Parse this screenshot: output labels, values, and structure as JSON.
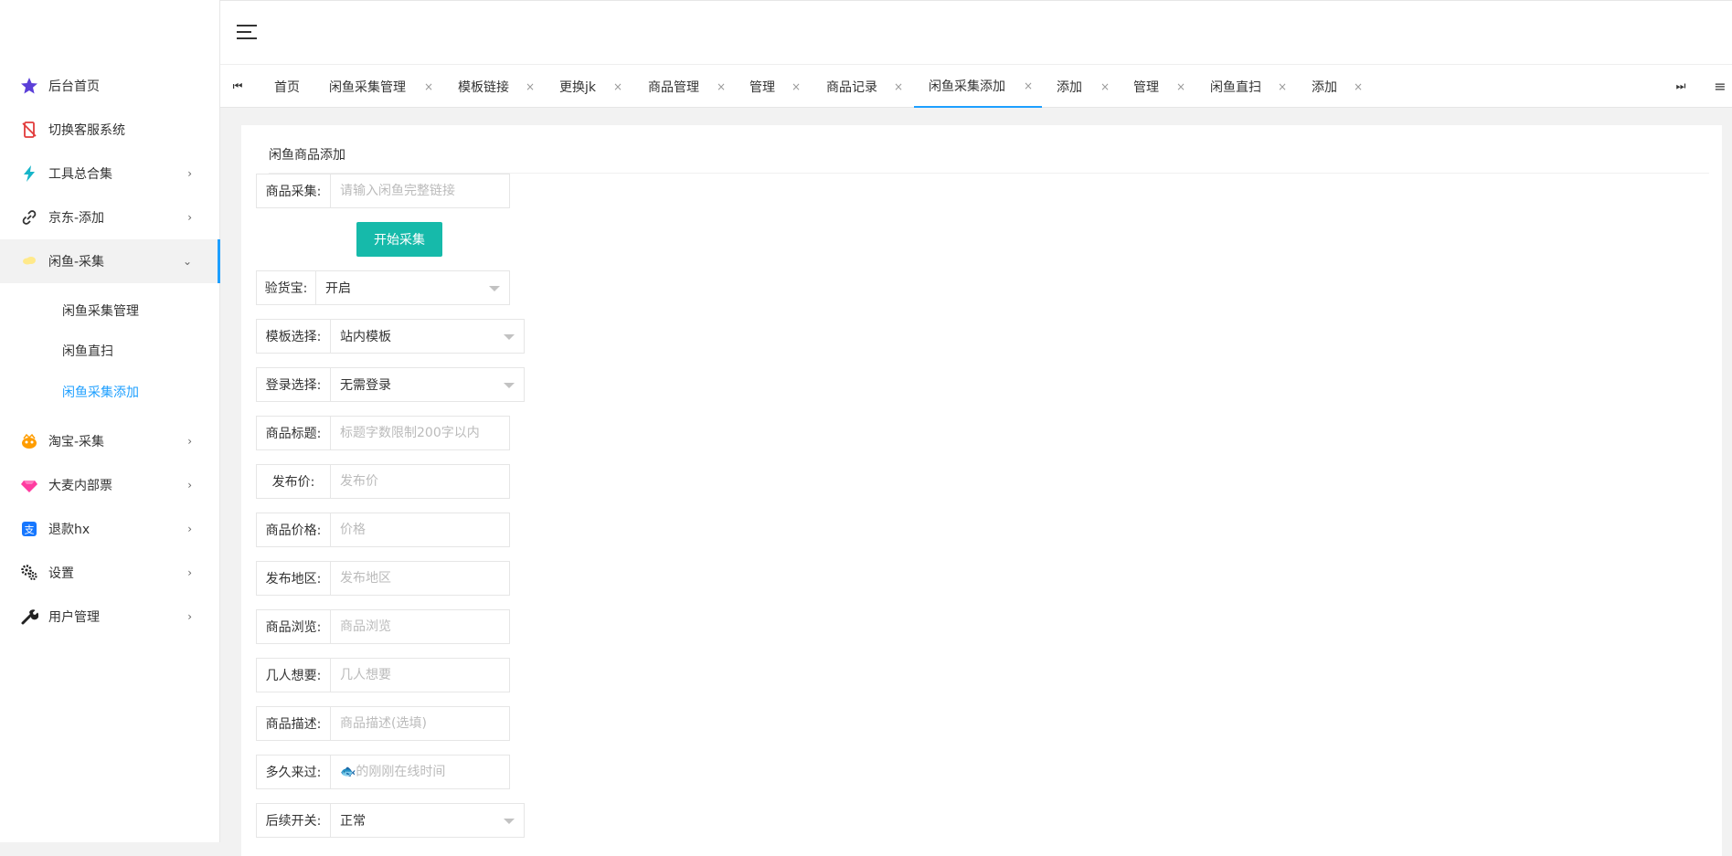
{
  "sidebar": {
    "items": [
      {
        "label": "后台首页",
        "icon": "star-icon"
      },
      {
        "label": "切换客服系统",
        "icon": "no-mobile-icon"
      },
      {
        "label": "工具总合集",
        "icon": "lightning-icon"
      },
      {
        "label": "京东-添加",
        "icon": "link-icon"
      },
      {
        "label": "闲鱼-采集",
        "icon": "cloud-icon"
      },
      {
        "label": "淘宝-采集",
        "icon": "taobao-icon"
      },
      {
        "label": "大麦内部票",
        "icon": "diamond-icon"
      },
      {
        "label": "退款hx",
        "icon": "alipay-icon"
      },
      {
        "label": "设置",
        "icon": "gears-icon"
      },
      {
        "label": "用户管理",
        "icon": "wrench-icon"
      }
    ],
    "submenu": [
      "闲鱼采集管理",
      "闲鱼直扫",
      "闲鱼采集添加"
    ]
  },
  "tabs": [
    "首页",
    "闲鱼采集管理",
    "模板链接",
    "更换jk",
    "商品管理",
    "管理",
    "商品记录",
    "闲鱼采集添加",
    "添加",
    "管理",
    "闲鱼直扫",
    "添加"
  ],
  "tab_nav": {
    "prev": "⏮",
    "next": "⏭",
    "menu": "≡",
    "close": "×"
  },
  "card_title": "闲鱼商品添加",
  "form": {
    "collect": {
      "label": "商品采集:",
      "placeholder": "请输入闲鱼完整链接"
    },
    "start_button": "开始采集",
    "inspection": {
      "label": "验货宝:",
      "value": "开启"
    },
    "template": {
      "label": "模板选择:",
      "value": "站内模板"
    },
    "login": {
      "label": "登录选择:",
      "value": "无需登录"
    },
    "title": {
      "label": "商品标题:",
      "placeholder": "标题字数限制200字以内"
    },
    "publish_price": {
      "label": "发布价:",
      "placeholder": "发布价"
    },
    "price": {
      "label": "商品价格:",
      "placeholder": "价格"
    },
    "region": {
      "label": "发布地区:",
      "placeholder": "发布地区"
    },
    "views": {
      "label": "商品浏览:",
      "placeholder": "商品浏览"
    },
    "wants": {
      "label": "几人想要:",
      "placeholder": "几人想要"
    },
    "description": {
      "label": "商品描述:",
      "placeholder": "商品描述(选填)"
    },
    "last_seen": {
      "label": "多久来过:",
      "placeholder": "🐟的刚刚在线时间"
    },
    "follow_switch": {
      "label": "后续开关:",
      "value": "正常"
    }
  },
  "colors": {
    "accent": "#1e9fff",
    "button": "#16baaa"
  }
}
